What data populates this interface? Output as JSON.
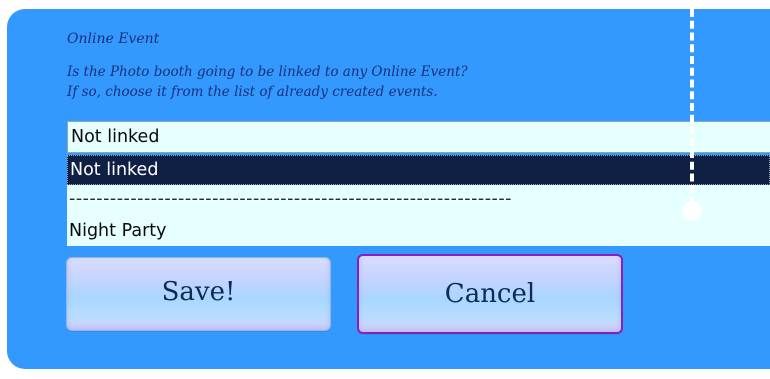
{
  "section": {
    "title": "Online Event",
    "description_line1": "Is the Photo booth going to be linked to any Online Event?",
    "description_line2": "If so, choose it from the list of already created events."
  },
  "event_select": {
    "value": "Not linked",
    "options": [
      "Not linked",
      "-----------------------------------------------------------------",
      "Night Party"
    ],
    "highlighted_option": "Not linked"
  },
  "buttons": {
    "save_label": "Save!",
    "cancel_label": "Cancel"
  },
  "colors": {
    "panel_background": "#3399ff",
    "select_background": "#e6ffff",
    "highlight_background": "#0f2044",
    "label_text": "#1a2f7a",
    "cancel_focus_border": "#8b1fb8"
  }
}
